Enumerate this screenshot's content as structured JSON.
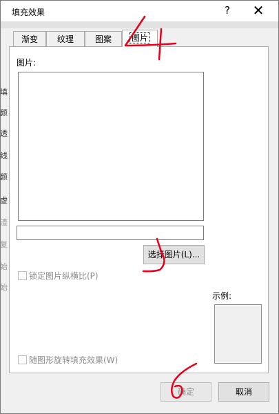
{
  "dialog": {
    "title": "填充效果",
    "help_icon": "?",
    "close_icon": "✕"
  },
  "tabs": [
    {
      "label": "渐变",
      "active": false
    },
    {
      "label": "纹理",
      "active": false
    },
    {
      "label": "图案",
      "active": false
    },
    {
      "label": "图片",
      "active": true
    }
  ],
  "panel": {
    "picture_label": "图片:",
    "file_value": "",
    "select_button": "选择图片(L)...",
    "lock_aspect_label": "锁定图片纵横比(P)",
    "rotate_label": "随图形旋转填充效果(W)",
    "example_label": "示例:"
  },
  "footer": {
    "ok_label": "确定",
    "cancel_label": "取消"
  },
  "background": {
    "letters": [
      "填",
      "颜",
      "透",
      "线",
      "颜",
      "虚",
      "渣",
      "复",
      "始",
      "始"
    ]
  },
  "annotations": {
    "step4": "4",
    "step6": "6"
  }
}
